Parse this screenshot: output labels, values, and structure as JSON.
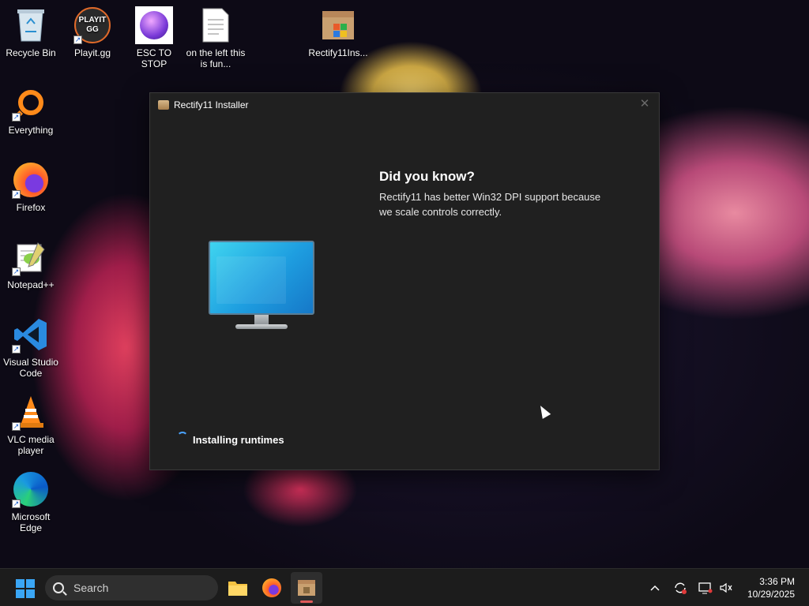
{
  "desktop": {
    "icons": [
      {
        "label": "Recycle Bin"
      },
      {
        "label": "Playit.gg"
      },
      {
        "label": "ESC TO STOP"
      },
      {
        "label": "on the left this is fun..."
      },
      {
        "label": "Rectify11Ins..."
      },
      {
        "label": "Everything"
      },
      {
        "label": "Firefox"
      },
      {
        "label": "Notepad++"
      },
      {
        "label": "Visual Studio Code"
      },
      {
        "label": "VLC media player"
      },
      {
        "label": "Microsoft Edge"
      }
    ],
    "playit_logo_text": "PLAYIT GG"
  },
  "installer": {
    "title": "Rectify11 Installer",
    "close_glyph": "✕",
    "tip_title": "Did you know?",
    "tip_body": "Rectify11 has better Win32 DPI support because we scale controls correctly.",
    "status": "Installing runtimes"
  },
  "taskbar": {
    "search_placeholder": "Search",
    "tray_chevron": "^",
    "time": "3:36 PM",
    "date": "10/29/2025"
  },
  "colors": {
    "accent": "#3aa6f5",
    "window_bg": "#202020",
    "taskbar_bg": "#1c1c1c"
  }
}
